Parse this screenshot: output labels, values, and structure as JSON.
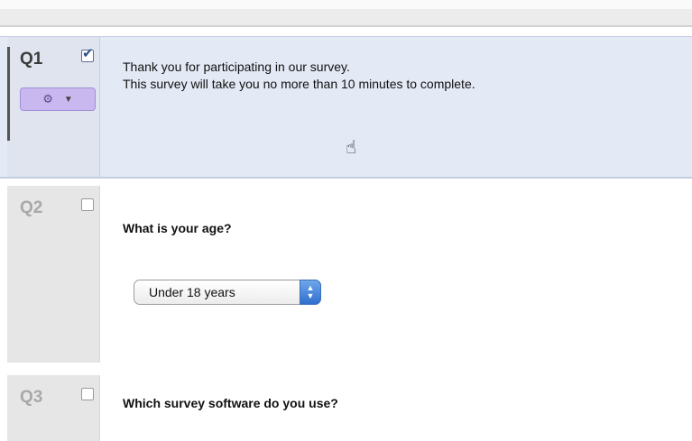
{
  "questions": [
    {
      "number": "Q1",
      "checked": true,
      "text": "Thank you for participating in our survey.\nThis survey will take you no more than 10 minutes to complete.",
      "settings_icon": "gear-icon"
    },
    {
      "number": "Q2",
      "checked": false,
      "text": "What is your age?",
      "dropdown": {
        "selected": "Under 18 years"
      }
    },
    {
      "number": "Q3",
      "checked": false,
      "text": "Which survey software do you use?"
    }
  ],
  "icons": {
    "gear": "⚙",
    "caret": "▼",
    "cursor": "hand-pointer-icon",
    "up_arrow": "▲",
    "down_arrow": "▼"
  },
  "colors": {
    "selected_row_bg": "#e3e9f5",
    "settings_button_bg": "#c9b8f0",
    "select_arrow_blue": "#2f6fd0"
  }
}
